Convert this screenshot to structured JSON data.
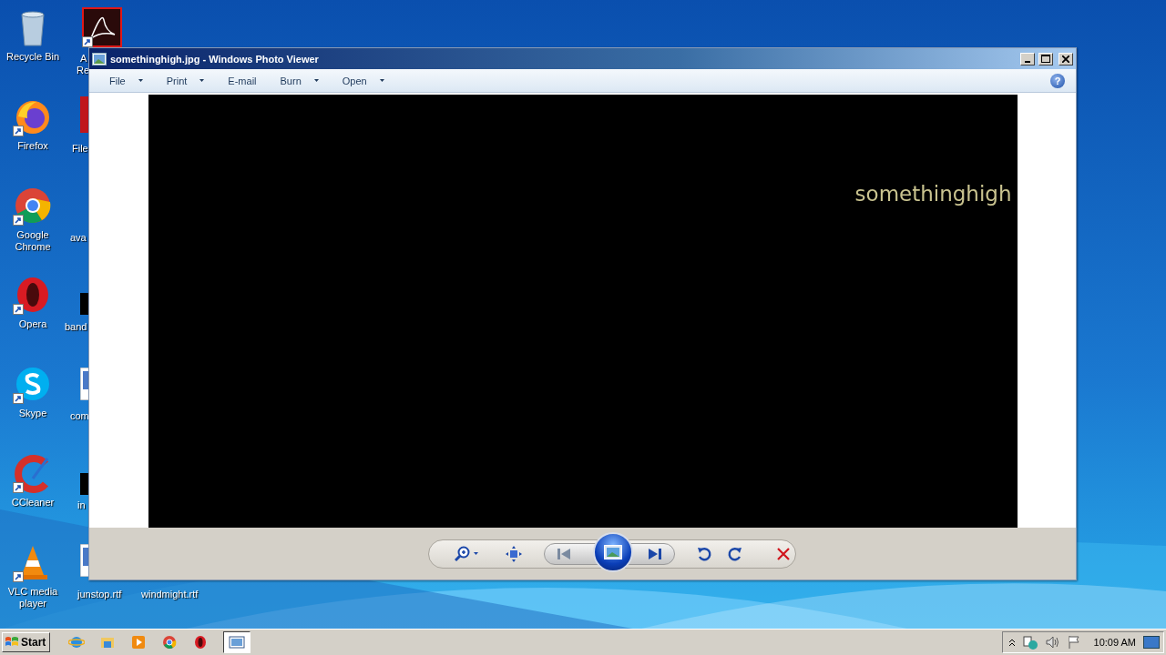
{
  "desktop": {
    "icons": [
      {
        "kind": "bin",
        "label": "Recycle Bin",
        "shortcut": false
      },
      {
        "kind": "firefox",
        "label": "Firefox",
        "shortcut": true
      },
      {
        "kind": "chrome",
        "label": "Google Chrome",
        "shortcut": true
      },
      {
        "kind": "opera",
        "label": "Opera",
        "shortcut": true
      },
      {
        "kind": "skype",
        "label": "Skype",
        "shortcut": true
      },
      {
        "kind": "ccleaner",
        "label": "CCleaner",
        "shortcut": true
      },
      {
        "kind": "vlc",
        "label": "VLC media player",
        "shortcut": true
      }
    ],
    "partial_icons": [
      {
        "kind": "acrobat",
        "label_lines": [
          "A",
          "Re"
        ]
      },
      {
        "kind": "red",
        "label_lines": [
          "File"
        ]
      },
      {
        "kind": "none",
        "label_lines": [
          "ava"
        ]
      },
      {
        "kind": "black",
        "label_lines": [
          "band"
        ]
      },
      {
        "kind": "doc",
        "label_lines": [
          "com"
        ]
      },
      {
        "kind": "black",
        "label_lines": [
          "in"
        ]
      },
      {
        "kind": "doc",
        "label_lines": [
          "junstop.rtf"
        ]
      },
      {
        "kind": "none",
        "label_lines": [
          "windmight.rtf"
        ]
      }
    ]
  },
  "window": {
    "title": "somethinghigh.jpg - Windows Photo Viewer",
    "menu": [
      {
        "label": "File",
        "dropdown": true
      },
      {
        "label": "Print",
        "dropdown": true
      },
      {
        "label": "E-mail",
        "dropdown": false
      },
      {
        "label": "Burn",
        "dropdown": true
      },
      {
        "label": "Open",
        "dropdown": true
      }
    ],
    "help": "?",
    "image_text": "somethinghigh"
  },
  "taskbar": {
    "start": "Start",
    "buttons": [
      {
        "kind": "ie",
        "selected": false
      },
      {
        "kind": "folder",
        "selected": false
      },
      {
        "kind": "media",
        "selected": false
      },
      {
        "kind": "chrome",
        "selected": false
      },
      {
        "kind": "opera",
        "selected": false
      },
      {
        "kind": "viewer",
        "selected": true
      }
    ],
    "clock": "10:09 AM"
  }
}
